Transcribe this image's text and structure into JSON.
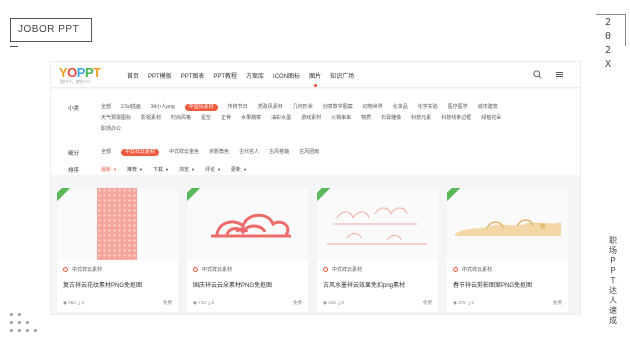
{
  "slide": {
    "brand": "JOBOR PPT",
    "year_digits": [
      "2",
      "0",
      "2",
      "X"
    ],
    "vertical_caption": "职场PPT达人速成",
    "colors": {
      "accent": "#f05a3c",
      "ribbon": "#5ab85c"
    }
  },
  "site": {
    "logo": {
      "y": "Y",
      "o": "O",
      "p1": "P",
      "p2": "P",
      "t": "T",
      "subtitle": "找PPT，就在YO"
    },
    "nav": [
      "首页",
      "PPT模板",
      "PPT图表",
      "PPT教程",
      "方案库",
      "ICON图标",
      "图片",
      "知识广场"
    ],
    "active_nav": "图片",
    "icons": {
      "search": "search-icon",
      "menu": "menu-icon"
    }
  },
  "filters": {
    "category_label": "小类",
    "categories_row1": [
      "全部",
      "2.5d插画",
      "3d小人png",
      "中国风素材",
      "传统节日",
      "党政风素材",
      "几何形状",
      "创意数字图案",
      "动物世界",
      "化妆品",
      "化学实验",
      "医疗医学"
    ],
    "categories_row2": [
      "城市建筑",
      "天气预报图标",
      "影视素材",
      "时尚风格",
      "星空",
      "正骨",
      "水果蔬菜",
      "油彩水墨",
      "游戏素材",
      "火锅串串",
      "物质",
      "石膏雕像",
      "科技元素"
    ],
    "categories_row3": [
      "科技线条边框",
      "绿植花朵",
      "职场办公"
    ],
    "active_category": "中国风素材",
    "sub_label": "细分",
    "subs": [
      "全部",
      "中式祥云素材",
      "中式祥云金色",
      "京剧角色",
      "古代名人",
      "古风卷轴",
      "古风团扇"
    ],
    "active_sub": "中式祥云素材",
    "sort_label": "排序",
    "sorts": [
      "最新",
      "推荐",
      "下载",
      "浏览",
      "评论",
      "更新"
    ],
    "active_sort": "最新"
  },
  "cards": [
    {
      "tag": "中式祥云素材",
      "title": "复古祥云花纹素材PNG免抠图",
      "views": "264",
      "downloads": "0",
      "price": "免费"
    },
    {
      "tag": "中式祥云素材",
      "title": "国庆祥云云朵素材PNG免抠图",
      "views": "713",
      "downloads": "0",
      "price": "免费"
    },
    {
      "tag": "中式祥云素材",
      "title": "古风水墨祥云效果免扣png素材",
      "views": "416",
      "downloads": "0",
      "price": "免费"
    },
    {
      "tag": "中式祥云素材",
      "title": "春节祥云剪影图案PNG免抠图",
      "views": "378",
      "downloads": "0",
      "price": "免费"
    }
  ]
}
